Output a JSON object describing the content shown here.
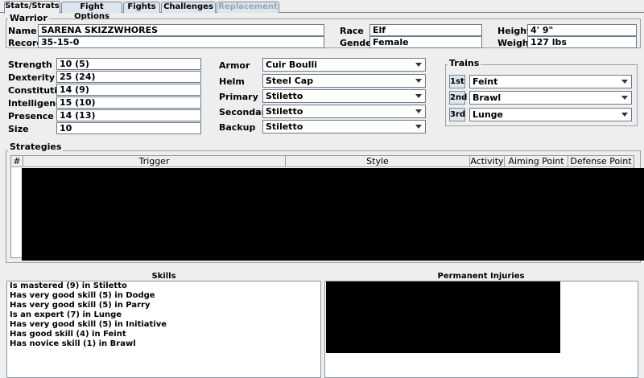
{
  "tabs": [
    "Stats/Strats",
    "Fight Options",
    "Fights",
    "Challenges",
    "Replacement"
  ],
  "warrior": {
    "group_title": "Warrior",
    "name_label": "Name",
    "name": "SARENA SKIZZWHORES",
    "record_label": "Record",
    "record": "35-15-0",
    "race_label": "Race",
    "race": "Elf",
    "gender_label": "Gender",
    "gender": "Female",
    "height_label": "Height",
    "height": "4' 9\"",
    "weight_label": "Weight",
    "weight": "127 lbs"
  },
  "stats": [
    {
      "label": "Strength",
      "value": "10 (5)"
    },
    {
      "label": "Dexterity",
      "value": "25 (24)"
    },
    {
      "label": "Constitution",
      "value": "14 (9)"
    },
    {
      "label": "Intelligence",
      "value": "15 (10)"
    },
    {
      "label": "Presence",
      "value": "14 (13)"
    },
    {
      "label": "Size",
      "value": "10"
    }
  ],
  "equipment": [
    {
      "label": "Armor",
      "value": "Cuir Boulli"
    },
    {
      "label": "Helm",
      "value": "Steel Cap"
    },
    {
      "label": "Primary",
      "value": "Stiletto"
    },
    {
      "label": "Secondary",
      "value": "Stiletto"
    },
    {
      "label": "Backup",
      "value": "Stiletto"
    }
  ],
  "trains": {
    "title": "Trains",
    "items": [
      {
        "order": "1st",
        "value": "Feint"
      },
      {
        "order": "2nd",
        "value": "Brawl"
      },
      {
        "order": "3rd",
        "value": "Lunge"
      }
    ]
  },
  "strategies": {
    "title": "Strategies",
    "columns": [
      "#",
      "Trigger",
      "Style",
      "Activity",
      "Aiming Point",
      "Defense Point"
    ]
  },
  "skills": {
    "title": "Skills",
    "items": [
      "Is mastered (9) in Stiletto",
      "Has very good skill (5) in Dodge",
      "Has very good skill (5) in Parry",
      "Is an expert (7) in Lunge",
      "Has very good skill (5) in Initiative",
      "Has good skill (4) in Feint",
      "Has novice skill (1) in Brawl"
    ]
  },
  "injuries": {
    "title": "Permanent Injuries"
  }
}
